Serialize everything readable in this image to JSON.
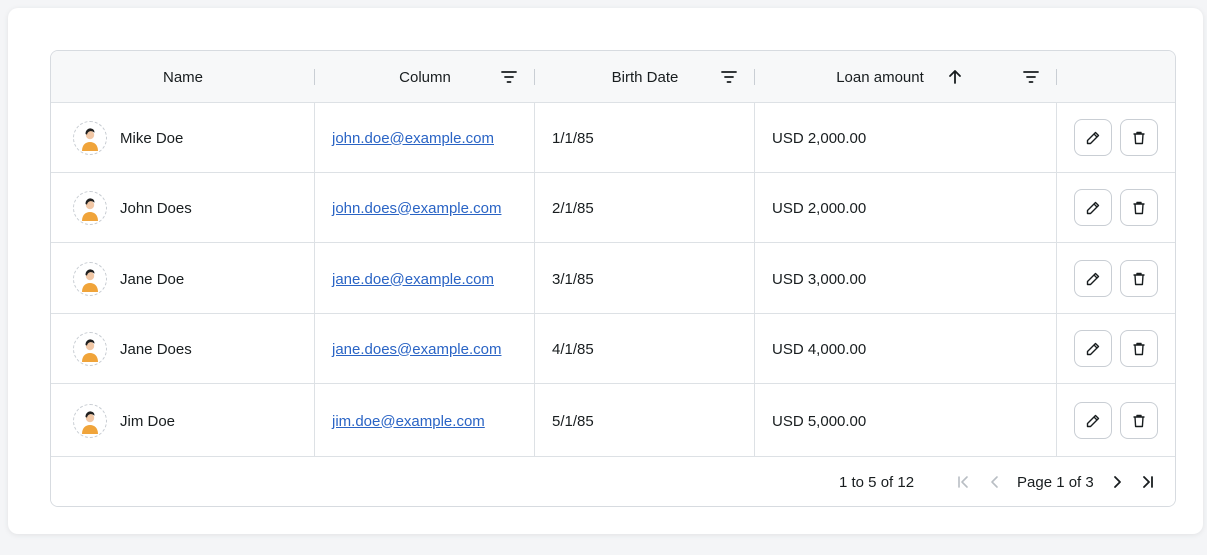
{
  "columns": {
    "name": "Name",
    "column": "Column",
    "birth_date": "Birth Date",
    "loan_amount": "Loan amount"
  },
  "rows": [
    {
      "name": "Mike Doe",
      "email": "john.doe@example.com",
      "birth_date": "1/1/85",
      "loan": "USD 2,000.00"
    },
    {
      "name": "John Does",
      "email": "john.does@example.com",
      "birth_date": "2/1/85",
      "loan": "USD 2,000.00"
    },
    {
      "name": "Jane Doe",
      "email": "jane.doe@example.com",
      "birth_date": "3/1/85",
      "loan": "USD 3,000.00"
    },
    {
      "name": "Jane Does",
      "email": "jane.does@example.com",
      "birth_date": "4/1/85",
      "loan": "USD 4,000.00"
    },
    {
      "name": "Jim Doe",
      "email": "jim.doe@example.com",
      "birth_date": "5/1/85",
      "loan": "USD 5,000.00"
    }
  ],
  "pagination": {
    "range": "1 to 5 of 12",
    "page": "Page 1 of 3"
  },
  "icons": {
    "filter": "filter-icon",
    "sort": "arrow-up-icon",
    "edit": "pencil-icon",
    "delete": "trash-icon",
    "first": "first-page-icon",
    "prev": "chevron-left-icon",
    "next": "chevron-right-icon",
    "last": "last-page-icon"
  },
  "colors": {
    "link": "#2a64c5",
    "header_bg": "#f7f8f9",
    "border": "#dde1e5",
    "avatar_shirt": "#f0a43a"
  }
}
